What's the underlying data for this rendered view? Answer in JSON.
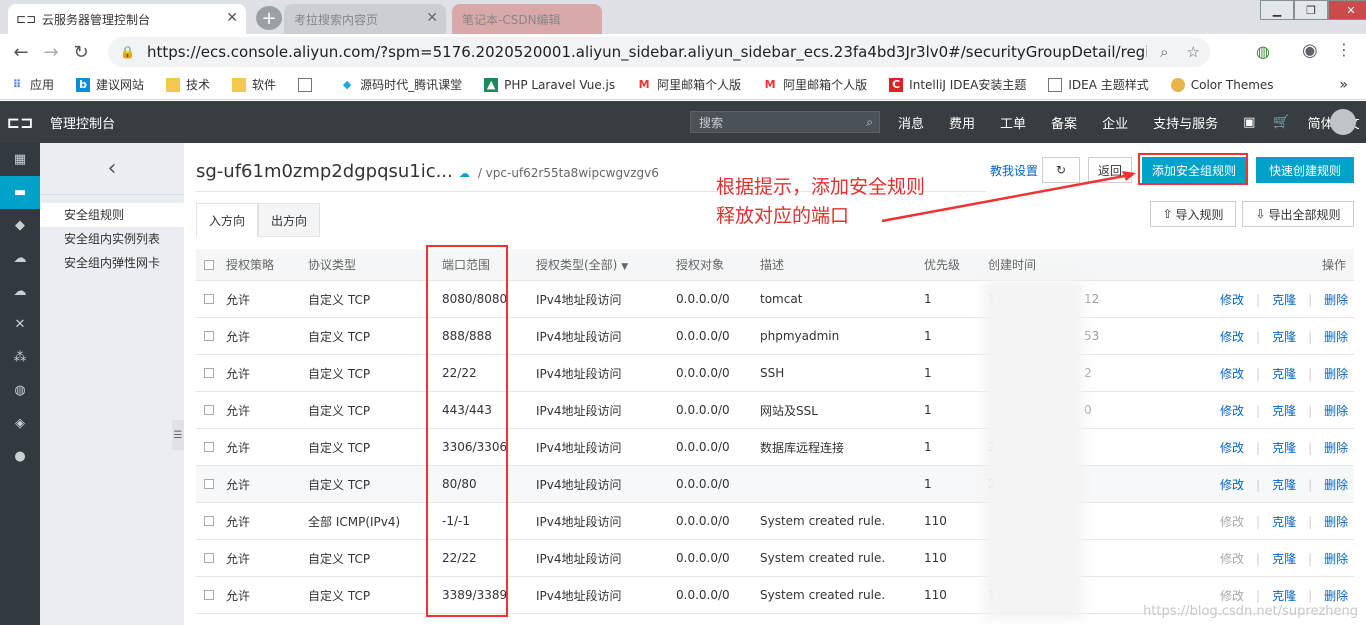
{
  "browser": {
    "tabs": [
      {
        "title": "云服务器管理控制台",
        "active": true
      },
      {
        "title": "考拉搜索内容页",
        "active": false
      },
      {
        "title": "笔记本-CSDN编辑",
        "active": false
      }
    ],
    "url": "https://ecs.console.aliyun.com/?spm=5176.2020520001.aliyun_sidebar.aliyun_sidebar_ecs.23fa4bd3Jr3lv0#/securityGroupDetail/region/cn-shanghai/gr...",
    "bookmarks": [
      "应用",
      "建议网站",
      "技术",
      "软件",
      "",
      "源码时代_腾讯课堂",
      "PHP Laravel Vue.js",
      "阿里邮箱个人版",
      "阿里邮箱个人版",
      "IntelliJ IDEA安装主题",
      "IDEA 主题样式",
      "Color Themes"
    ]
  },
  "topbar": {
    "title": "管理控制台",
    "search_placeholder": "搜索",
    "nav": [
      "消息",
      "费用",
      "工单",
      "备案",
      "企业",
      "支持与服务",
      "",
      "",
      "简体中文"
    ]
  },
  "sidebar": {
    "items": [
      "安全组规则",
      "安全组内实例列表",
      "安全组内弹性网卡"
    ]
  },
  "header": {
    "group_id": "sg-uf61m0zmp2dgpqsu1ic...",
    "vpc": "/ vpc-uf62r55ta8wipcwgvzgv6",
    "help": "教我设置",
    "back": "返回",
    "add_rule": "添加安全组规则",
    "quick_rule": "快速创建规则",
    "import": "导入规则",
    "export": "导出全部规则"
  },
  "tabs": [
    "入方向",
    "出方向"
  ],
  "annotation": [
    "根据提示，添加安全规则",
    "释放对应的端口"
  ],
  "table": {
    "columns": [
      "授权策略",
      "协议类型",
      "端口范围",
      "授权类型(全部)",
      "授权对象",
      "描述",
      "优先级",
      "创建时间",
      "操作"
    ],
    "actions": [
      "修改",
      "克隆",
      "删除"
    ],
    "rows": [
      {
        "policy": "允许",
        "protocol": "自定义 TCP",
        "port": "8080/8080",
        "auth": "IPv4地址段访问",
        "target": "0.0.0.0/0",
        "desc": "tomcat",
        "priority": "1",
        "time_start": "1",
        "time_end": "12",
        "edit_disabled": false
      },
      {
        "policy": "允许",
        "protocol": "自定义 TCP",
        "port": "888/888",
        "auth": "IPv4地址段访问",
        "target": "0.0.0.0/0",
        "desc": "phpmyadmin",
        "priority": "1",
        "time_start": "",
        "time_end": "53",
        "edit_disabled": false
      },
      {
        "policy": "允许",
        "protocol": "自定义 TCP",
        "port": "22/22",
        "auth": "IPv4地址段访问",
        "target": "0.0.0.0/0",
        "desc": "SSH",
        "priority": "1",
        "time_start": "",
        "time_end": "2",
        "edit_disabled": false
      },
      {
        "policy": "允许",
        "protocol": "自定义 TCP",
        "port": "443/443",
        "auth": "IPv4地址段访问",
        "target": "0.0.0.0/0",
        "desc": "网站及SSL",
        "priority": "1",
        "time_start": "",
        "time_end": "0",
        "edit_disabled": false
      },
      {
        "policy": "允许",
        "protocol": "自定义 TCP",
        "port": "3306/3306",
        "auth": "IPv4地址段访问",
        "target": "0.0.0.0/0",
        "desc": "数据库远程连接",
        "priority": "1",
        "time_start": "2",
        "time_end": "",
        "edit_disabled": false
      },
      {
        "policy": "允许",
        "protocol": "自定义 TCP",
        "port": "80/80",
        "auth": "IPv4地址段访问",
        "target": "0.0.0.0/0",
        "desc": "",
        "priority": "1",
        "time_start": "2",
        "time_end": "",
        "edit_disabled": false
      },
      {
        "policy": "允许",
        "protocol": "全部 ICMP(IPv4)",
        "port": "-1/-1",
        "auth": "IPv4地址段访问",
        "target": "0.0.0.0/0",
        "desc": "System created rule.",
        "priority": "110",
        "time_start": "",
        "time_end": "",
        "edit_disabled": true
      },
      {
        "policy": "允许",
        "protocol": "自定义 TCP",
        "port": "22/22",
        "auth": "IPv4地址段访问",
        "target": "0.0.0.0/0",
        "desc": "System created rule.",
        "priority": "110",
        "time_start": "",
        "time_end": "",
        "edit_disabled": true
      },
      {
        "policy": "允许",
        "protocol": "自定义 TCP",
        "port": "3389/3389",
        "auth": "IPv4地址段访问",
        "target": "0.0.0.0/0",
        "desc": "System created rule.",
        "priority": "110",
        "time_start": "1",
        "time_end": "",
        "edit_disabled": true
      }
    ]
  },
  "watermark": "https://blog.csdn.net/suprezheng",
  "colors": {
    "accent": "#00a2ca",
    "link": "#0066cc",
    "annotation": "#e03030",
    "topbar": "#373d41"
  }
}
